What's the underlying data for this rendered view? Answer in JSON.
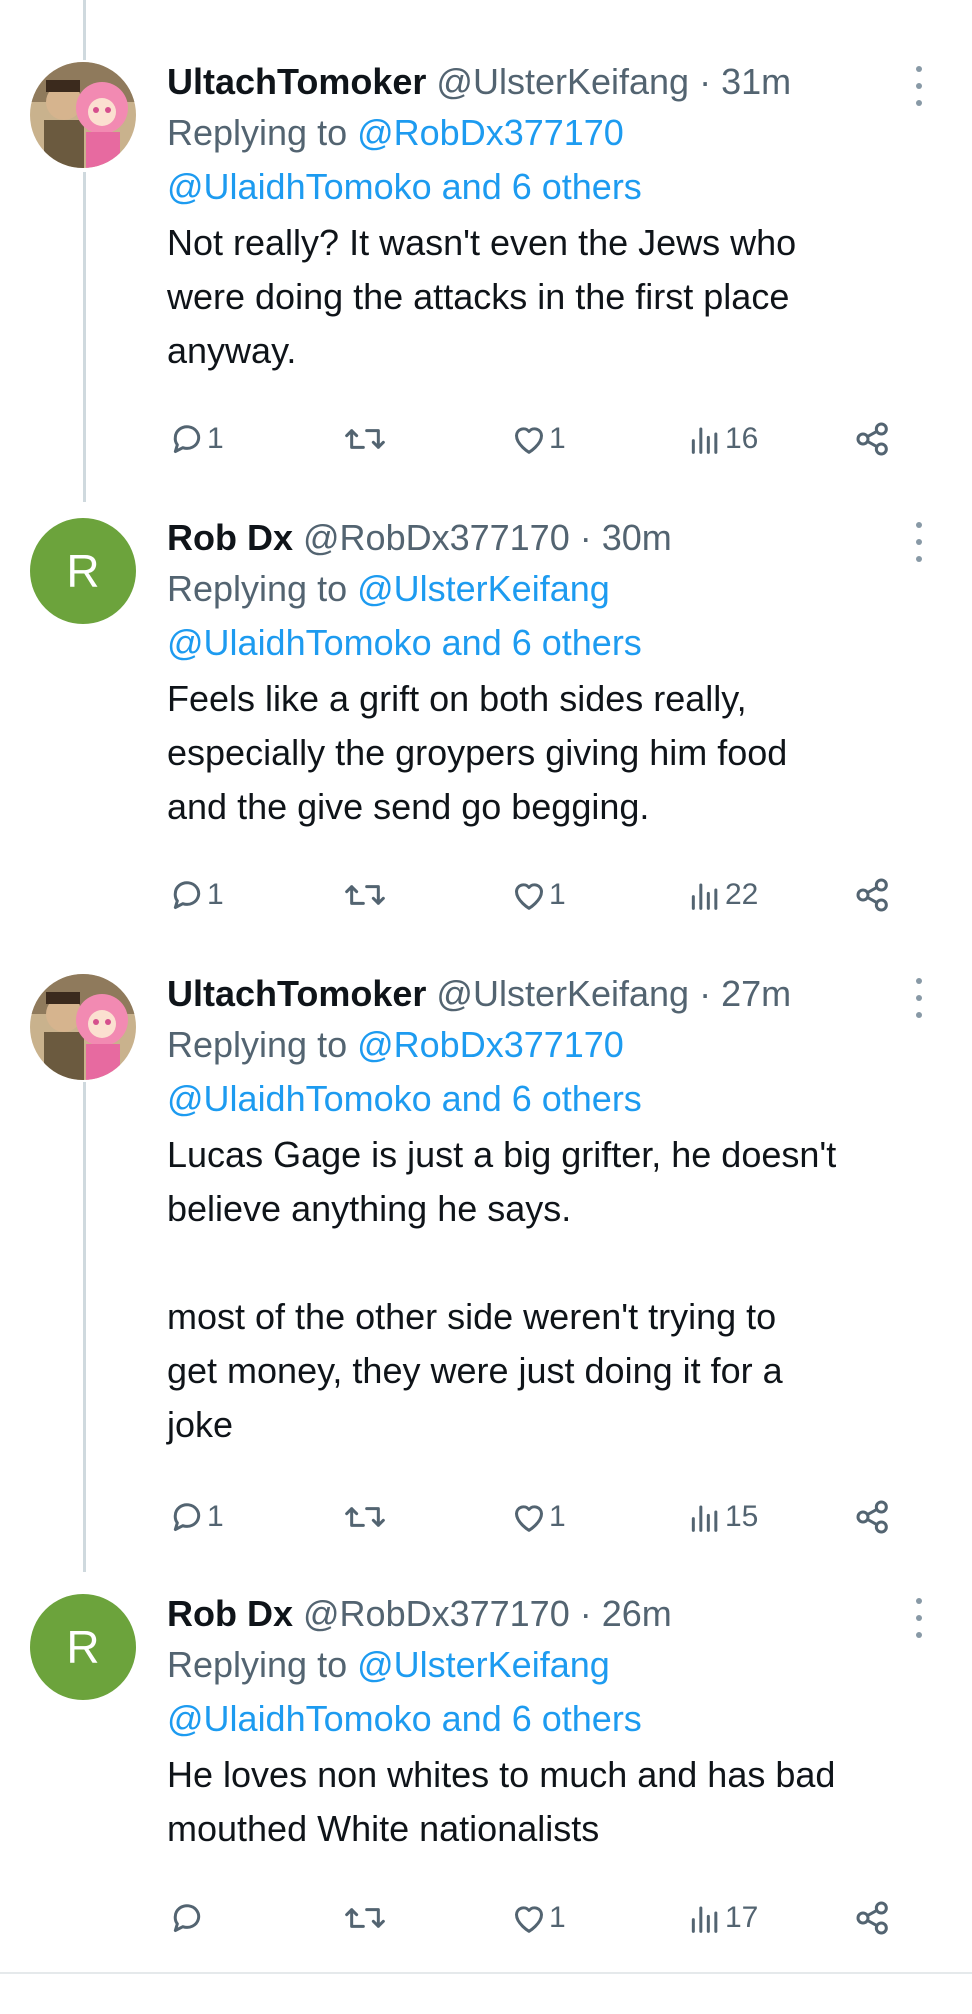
{
  "tweets": [
    {
      "name": "UltachTomoker",
      "handle": "@UlsterKeifang",
      "time": "31m",
      "replying_prefix": "Replying to ",
      "replying_to": "@RobDx377170",
      "mentions": "@UlaidhTomoko and 6 others",
      "text": "Not really? It wasn't even the Jews who\nwere doing the attacks in the first place\nanyway.",
      "replies": "1",
      "retweets": "",
      "likes": "1",
      "views": "16",
      "avatar_icon": "photo-avatar"
    },
    {
      "name": "Rob Dx",
      "handle": "@RobDx377170",
      "time": "30m",
      "replying_prefix": "Replying to ",
      "replying_to": "@UlsterKeifang",
      "mentions": "@UlaidhTomoko and 6 others",
      "text": "Feels like a grift on both sides really,\nespecially the groypers giving him food\nand the give send go begging.",
      "replies": "1",
      "retweets": "",
      "likes": "1",
      "views": "22",
      "avatar_letter": "R"
    },
    {
      "name": "UltachTomoker",
      "handle": "@UlsterKeifang",
      "time": "27m",
      "replying_prefix": "Replying to ",
      "replying_to": "@RobDx377170",
      "mentions": "@UlaidhTomoko and 6 others",
      "text": "Lucas Gage is just a big grifter, he doesn't\nbelieve anything he says.\n\nmost of the other side weren't trying to\nget money, they were just doing it for a\njoke",
      "replies": "1",
      "retweets": "",
      "likes": "1",
      "views": "15",
      "avatar_icon": "photo-avatar"
    },
    {
      "name": "Rob Dx",
      "handle": "@RobDx377170",
      "time": "26m",
      "replying_prefix": "Replying to ",
      "replying_to": "@UlsterKeifang",
      "mentions": "@UlaidhTomoko and 6 others",
      "text": "He loves non whites to much and has bad\nmouthed White nationalists",
      "replies": "",
      "retweets": "",
      "likes": "1",
      "views": "17",
      "avatar_letter": "R"
    }
  ],
  "colors": {
    "link": "#1d9bf0",
    "secondary_text": "#536471",
    "avatar_green": "#6ca33c",
    "thread_line": "#cfd9de"
  }
}
